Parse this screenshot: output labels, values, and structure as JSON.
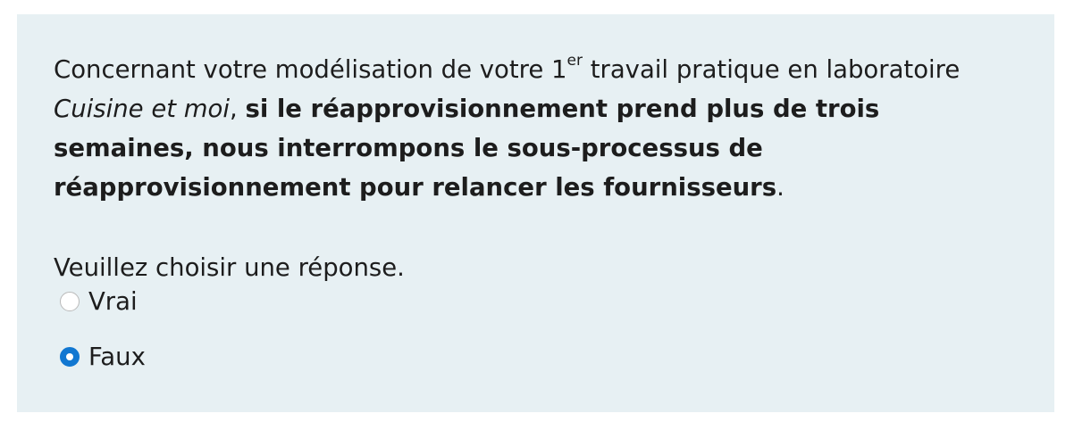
{
  "question": {
    "part1": "Concernant votre modélisation de votre 1",
    "superscript": "er",
    "part2": " travail pratique en laboratoire ",
    "italic": "Cuisine et moi",
    "part3": ", ",
    "bold": "si le réapprovisionnement prend plus de trois semaines, nous interrompons le sous-processus de réapprovisionnement pour relancer les fournisseurs",
    "part4": "."
  },
  "prompt": "Veuillez choisir une réponse.",
  "options": [
    {
      "label": "Vrai",
      "selected": false
    },
    {
      "label": "Faux",
      "selected": true
    }
  ],
  "colors": {
    "panel_background": "#e7f0f3",
    "radio_selected": "#1177d1"
  }
}
